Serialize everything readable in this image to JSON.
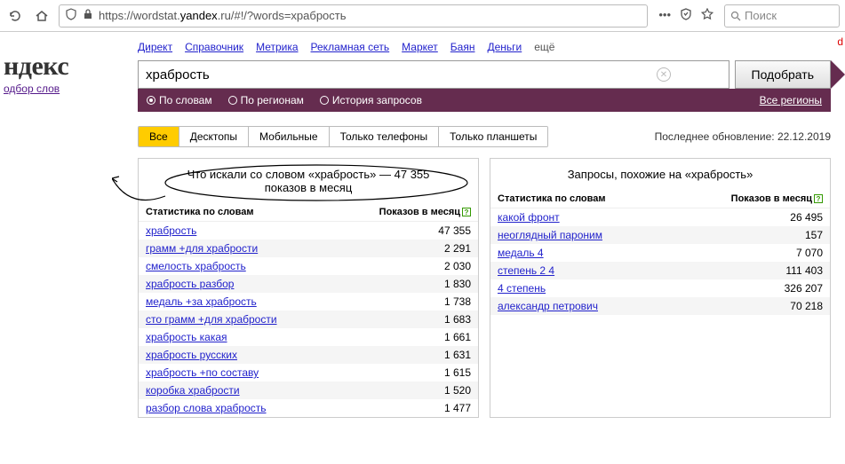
{
  "browser": {
    "url_prefix": "https://wordstat.",
    "url_host": "yandex",
    "url_suffix": ".ru/#!/?words=храбрость",
    "search_placeholder": "Поиск"
  },
  "top_links": [
    "Директ",
    "Справочник",
    "Метрика",
    "Рекламная сеть",
    "Маркет",
    "Баян",
    "Деньги"
  ],
  "top_more": "ещё",
  "logo": "ндекс",
  "logo_sub": "одбор слов",
  "query": "храбрость",
  "submit": "Подобрать",
  "options": {
    "by_words": "По словам",
    "by_regions": "По регионам",
    "history": "История запросов",
    "all_regions": "Все регионы"
  },
  "tabs": [
    "Все",
    "Десктопы",
    "Мобильные",
    "Только телефоны",
    "Только планшеты"
  ],
  "last_update_label": "Последнее обновление:",
  "last_update_value": "22.12.2019",
  "left": {
    "title_prefix": "Что искали со словом «",
    "title_word": "храбрость",
    "title_mid": "» — ",
    "title_count": "47 355",
    "title_suffix": "показов в месяц",
    "head1": "Статистика по словам",
    "head2": "Показов в месяц",
    "rows": [
      {
        "q": "храбрость",
        "n": "47 355"
      },
      {
        "q": "грамм +для храбрости",
        "n": "2 291"
      },
      {
        "q": "смелость храбрость",
        "n": "2 030"
      },
      {
        "q": "храбрость разбор",
        "n": "1 830"
      },
      {
        "q": "медаль +за храбрость",
        "n": "1 738"
      },
      {
        "q": "сто грамм +для храбрости",
        "n": "1 683"
      },
      {
        "q": "храбрость какая",
        "n": "1 661"
      },
      {
        "q": "храбрость русских",
        "n": "1 631"
      },
      {
        "q": "храбрость +по составу",
        "n": "1 615"
      },
      {
        "q": "коробка храбрости",
        "n": "1 520"
      },
      {
        "q": "разбор слова храбрость",
        "n": "1 477"
      }
    ]
  },
  "right": {
    "title_prefix": "Запросы, похожие на «",
    "title_word": "храбрость",
    "title_suffix": "»",
    "head1": "Статистика по словам",
    "head2": "Показов в месяц",
    "rows": [
      {
        "q": "какой фронт",
        "n": "26 495"
      },
      {
        "q": "неоглядный пароним",
        "n": "157"
      },
      {
        "q": "медаль 4",
        "n": "7 070"
      },
      {
        "q": "степень 2 4",
        "n": "111 403"
      },
      {
        "q": "4 степень",
        "n": "326 207"
      },
      {
        "q": "александр петрович",
        "n": "70 218"
      }
    ]
  },
  "corner": "d"
}
